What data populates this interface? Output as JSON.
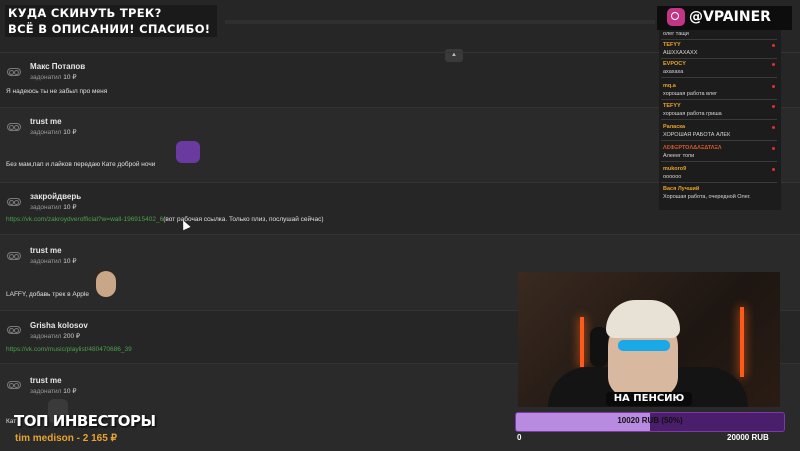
{
  "overlay": {
    "banner_line1": "КУДА СКИНУТЬ ТРЕК?",
    "banner_line2": "ВСЁ В ОПИСАНИИ! СПАСИБО!",
    "handle": "@VPAINER"
  },
  "donations": [
    {
      "name": "Макс Потапов",
      "donated_prefix": "задонатил",
      "amount": "10 ₽",
      "message": "Я надеюсь ты не забыл про меня"
    },
    {
      "name": "trust me",
      "donated_prefix": "задонатил",
      "amount": "10 ₽",
      "message": "Без мам,пап и лайков передаю Кате доброй ночи"
    },
    {
      "name": "закройдверь",
      "donated_prefix": "задонатил",
      "amount": "10 ₽",
      "link": "https://vk.com/zakroydverofficial?w=wall-196915402_6",
      "message": "(вот рабочая ссылка. Только плиз, послушай сейчас)"
    },
    {
      "name": "trust me",
      "donated_prefix": "задонатил",
      "amount": "10 ₽",
      "message": "LAFFY, добавь трек в Apple"
    },
    {
      "name": "Grisha kolosov",
      "donated_prefix": "задонатил",
      "amount": "200 ₽",
      "link": "https://vk.com/music/playlist/480470686_39"
    },
    {
      "name": "trust me",
      "donated_prefix": "задонатил",
      "amount": "10 ₽",
      "message": "Кат"
    }
  ],
  "chat": [
    {
      "name": "",
      "text": "олег тащи"
    },
    {
      "name": "TEFYY",
      "text": "АШХХАХАХХ"
    },
    {
      "name": "EVPOCY",
      "text": "ахахаха"
    },
    {
      "name": "mq.a",
      "text": "хорошая работа влег"
    },
    {
      "name": "TEFYY",
      "text": "хорошая работа гриша"
    },
    {
      "name": "Раласка",
      "text": "ХОРОШАЯ РАБОТА АЛЕК"
    },
    {
      "name": "ΛƐФΞРТОΛΔΛΞΔΤΛΞΛ",
      "text": "Алееег топи"
    },
    {
      "name": "mukoro9",
      "text": "оооооо"
    },
    {
      "name": "Вася Лучший",
      "text": "Хорошая работа, очередной Олег."
    }
  ],
  "goal": {
    "label": "НА ПЕНСИЮ",
    "progress_text": "10020 RUB (50%)",
    "progress_fraction": 0.501,
    "min": "0",
    "max": "20000 RUB"
  },
  "top_investors": {
    "title": "ТОП ИНВЕСТОРЫ",
    "entry": "tim medison - 2 165 ₽"
  }
}
